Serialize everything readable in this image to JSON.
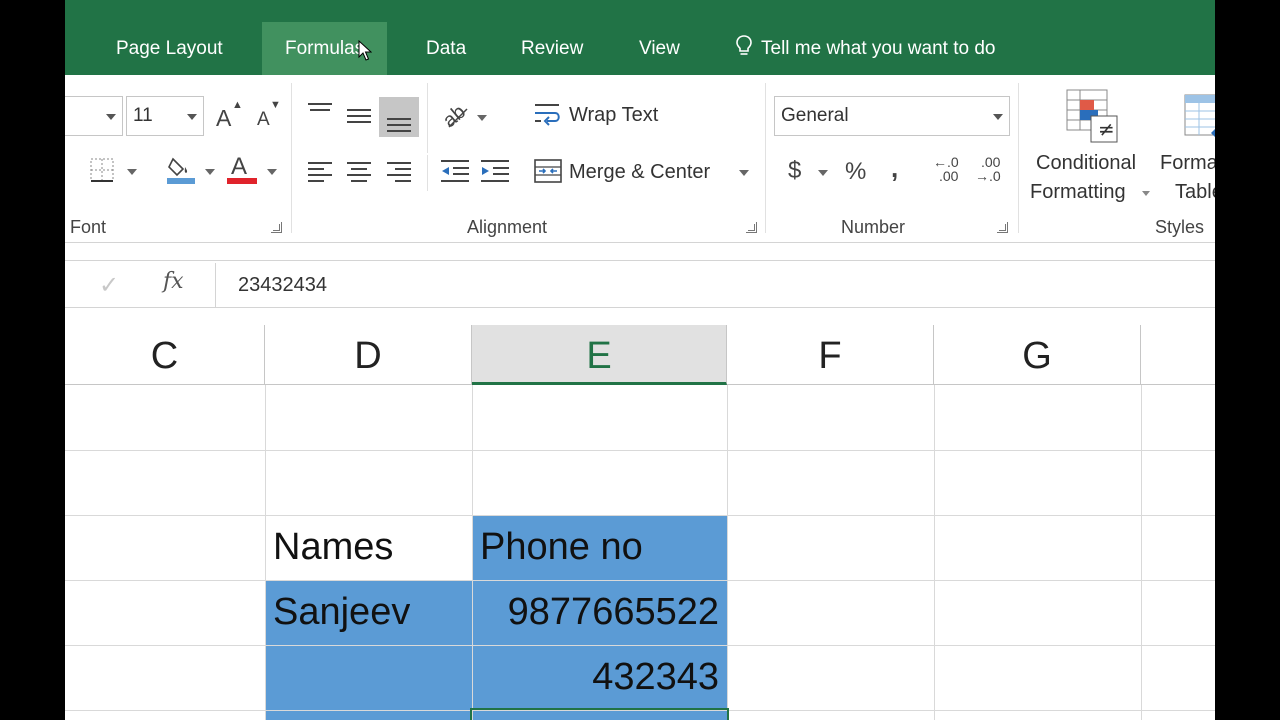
{
  "tabs": {
    "page_layout": "Page Layout",
    "formulas": "Formulas",
    "data": "Data",
    "review": "Review",
    "view": "View",
    "tell_me": "Tell me what you want to do"
  },
  "ribbon": {
    "font": {
      "size": "11",
      "grow_label": "A",
      "shrink_label": "A",
      "group_label": "Font"
    },
    "alignment": {
      "wrap_text": "Wrap Text",
      "merge_center": "Merge & Center",
      "group_label": "Alignment"
    },
    "number": {
      "format": "General",
      "currency": "$",
      "percent": "%",
      "comma": ",",
      "increase_decimal_top": "←.0",
      "increase_decimal_bottom": ".00",
      "decrease_decimal_top": ".00",
      "decrease_decimal_bottom": "→.0",
      "group_label": "Number"
    },
    "styles": {
      "conditional_line1": "Conditional",
      "conditional_line2": "Formatting",
      "format_table_line1": "Format as",
      "format_table_line2": "Table",
      "group_label": "Styles"
    }
  },
  "formula_bar": {
    "fx": "fx",
    "value": "23432434"
  },
  "sheet": {
    "columns": [
      "C",
      "D",
      "E",
      "F",
      "G"
    ],
    "selected_column": "E",
    "cells": {
      "d3": "Names",
      "e3": "Phone no",
      "d4": "Sanjeev",
      "e4": "9877665522",
      "e5": "432343"
    },
    "fill_color": "#5b9bd5",
    "accent_color": "#217346"
  }
}
